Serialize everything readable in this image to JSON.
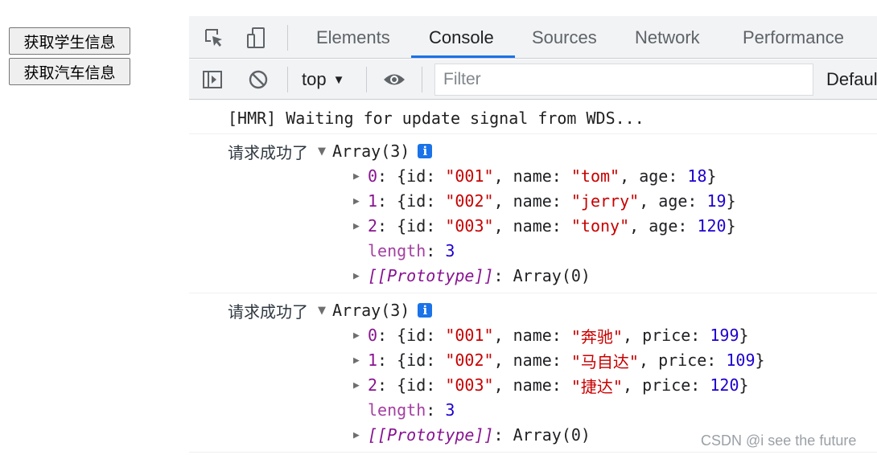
{
  "page": {
    "buttons": [
      "获取学生信息",
      "获取汽车信息"
    ]
  },
  "devtools": {
    "tabs": [
      "Elements",
      "Console",
      "Sources",
      "Network",
      "Performance"
    ],
    "active_tab": "Console",
    "toolbar": {
      "context": "top",
      "context_arrow": "▼",
      "filter_placeholder": "Filter",
      "levels_label": "Default levels"
    },
    "console": {
      "hmr": "[HMR] Waiting for update signal from WDS...",
      "groups": [
        {
          "label": "请求成功了",
          "array_head": "Array(3)",
          "field3_key": "age",
          "items": [
            {
              "index": "0",
              "id": "\"001\"",
              "name": "\"tom\"",
              "val": "18"
            },
            {
              "index": "1",
              "id": "\"002\"",
              "name": "\"jerry\"",
              "val": "19"
            },
            {
              "index": "2",
              "id": "\"003\"",
              "name": "\"tony\"",
              "val": "120"
            }
          ],
          "length_key": "length",
          "length_val": "3",
          "proto_key": "[[Prototype]]",
          "proto_val": "Array(0)"
        },
        {
          "label": "请求成功了",
          "array_head": "Array(3)",
          "field3_key": "price",
          "items": [
            {
              "index": "0",
              "id": "\"001\"",
              "name": "\"奔驰\"",
              "val": "199"
            },
            {
              "index": "1",
              "id": "\"002\"",
              "name": "\"马自达\"",
              "val": "109"
            },
            {
              "index": "2",
              "id": "\"003\"",
              "name": "\"捷达\"",
              "val": "120"
            }
          ],
          "length_key": "length",
          "length_val": "3",
          "proto_key": "[[Prototype]]",
          "proto_val": "Array(0)"
        }
      ]
    }
  },
  "watermark": "CSDN @i see the future",
  "colors": {
    "accent": "#1a73e8",
    "key": "#881391",
    "string": "#c80000",
    "number": "#1c00cf"
  }
}
